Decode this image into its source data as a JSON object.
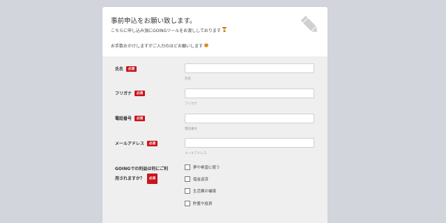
{
  "form": {
    "title": "事前申込をお願い致します。",
    "description_line1": "こちらに申し込み頂にGOINGツールをお渡ししております",
    "description_line2": "お手数おかけしますがご入力のほどお願いします",
    "required_label": "必須",
    "fields": [
      {
        "label": "氏名",
        "value": "",
        "help": "氏名"
      },
      {
        "label": "フリガナ",
        "value": "",
        "help": "フリガナ"
      },
      {
        "label": "電話番号",
        "value": "",
        "help": "電話番号"
      },
      {
        "label": "メールアドレス",
        "value": "",
        "help": "メールアドレス"
      }
    ],
    "usage_question": {
      "line1": "GOINGでの利益は何にご利",
      "line2": "用されますか？",
      "options": [
        {
          "label": "夢や希望に使う",
          "checked": false
        },
        {
          "label": "借金返済",
          "checked": false
        },
        {
          "label": "生活費の補填",
          "checked": false
        },
        {
          "label": "貯蓄や投資",
          "checked": false
        }
      ]
    }
  },
  "icons": {
    "header": "pencil-icon",
    "trophy": "trophy-emoji-icon",
    "smile": "smile-emoji-icon"
  },
  "colors": {
    "background": "#d3d5dc",
    "card": "#efefef",
    "header": "#ffffff",
    "required_badge": "#c9151e"
  }
}
